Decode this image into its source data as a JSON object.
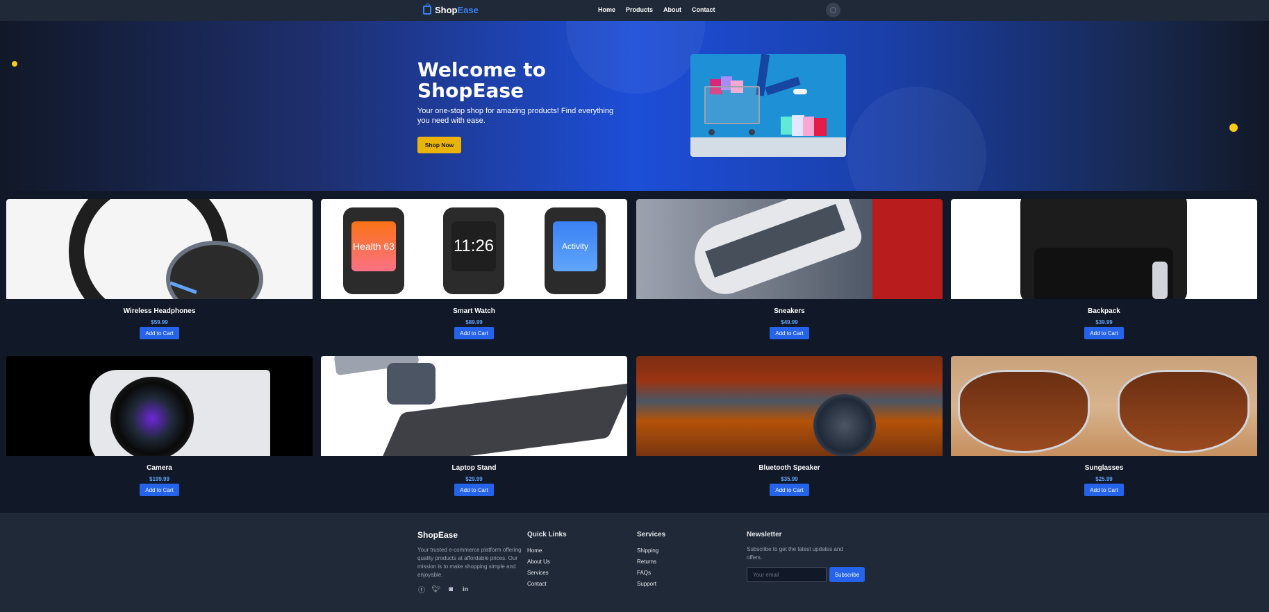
{
  "nav": {
    "brand_shop": "Shop",
    "brand_ease": "Ease",
    "links": [
      "Home",
      "Products",
      "About",
      "Contact"
    ],
    "theme_toggle_icon": "moon-icon"
  },
  "hero": {
    "title": "Welcome to ShopEase",
    "subtitle": "Your one-stop shop for amazing products! Find everything you need with ease.",
    "cta": "Shop Now",
    "accent_color": "#eab308"
  },
  "products": [
    {
      "name": "Wireless Headphones",
      "price": "$59.99",
      "button": "Add to Cart"
    },
    {
      "name": "Smart Watch",
      "price": "$89.99",
      "button": "Add to Cart"
    },
    {
      "name": "Sneakers",
      "price": "$49.99",
      "button": "Add to Cart"
    },
    {
      "name": "Backpack",
      "price": "$39.99",
      "button": "Add to Cart"
    },
    {
      "name": "Camera",
      "price": "$199.99",
      "button": "Add to Cart"
    },
    {
      "name": "Laptop Stand",
      "price": "$29.99",
      "button": "Add to Cart"
    },
    {
      "name": "Bluetooth Speaker",
      "price": "$35.99",
      "button": "Add to Cart"
    },
    {
      "name": "Sunglasses",
      "price": "$25.99",
      "button": "Add to Cart"
    }
  ],
  "watch_screens": [
    "Health 63",
    "11:26",
    "Activity"
  ],
  "footer": {
    "brand": "ShopEase",
    "description": "Your trusted e-commerce platform offering quality products at affordable prices. Our mission is to make shopping simple and enjoyable.",
    "socials": [
      "facebook-icon",
      "twitter-icon",
      "instagram-icon",
      "linkedin-icon"
    ],
    "quick_links": {
      "title": "Quick Links",
      "items": [
        "Home",
        "About Us",
        "Services",
        "Contact"
      ]
    },
    "services": {
      "title": "Services",
      "items": [
        "Shipping",
        "Returns",
        "FAQs",
        "Support"
      ]
    },
    "newsletter": {
      "title": "Newsletter",
      "text": "Subscribe to get the latest updates and offers.",
      "placeholder": "Your email",
      "button": "Subscribe"
    }
  },
  "colors": {
    "primary": "#2563eb",
    "price": "#60a5fa",
    "background": "#111827",
    "surface": "#1f2937"
  }
}
